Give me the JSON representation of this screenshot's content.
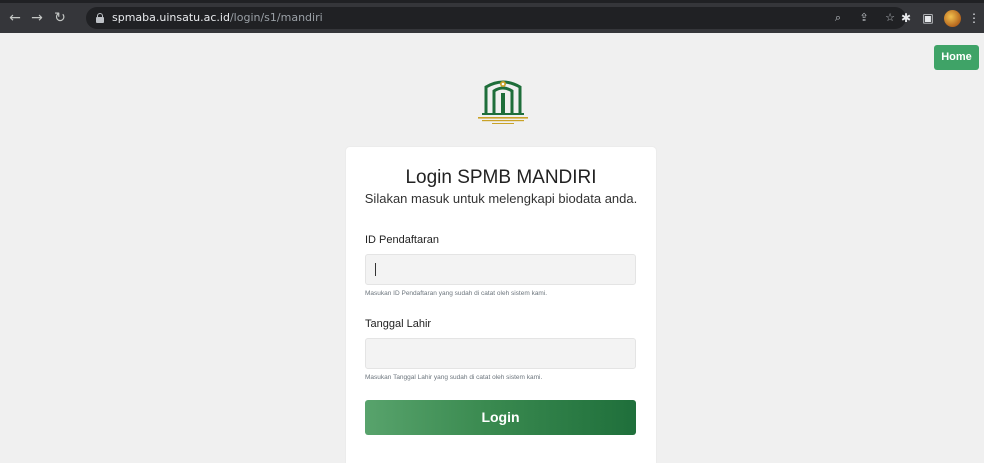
{
  "browser": {
    "url_host": "spmaba.uinsatu.ac.id",
    "url_path": "/login/s1/mandiri",
    "icons": [
      "back-arrow-icon",
      "forward-arrow-icon",
      "reload-icon",
      "lock-icon",
      "zoom-icon",
      "share-icon",
      "star-icon",
      "extensions-icon",
      "sidepanel-icon",
      "profile-avatar-icon",
      "more-menu-icon"
    ]
  },
  "header": {
    "home_label": "Home"
  },
  "logo": {
    "icon": "university-logo-icon"
  },
  "login": {
    "title": "Login SPMB MANDIRI",
    "subtitle": "Silakan masuk untuk melengkapi biodata anda.",
    "id_label": "ID Pendaftaran",
    "id_value": "",
    "id_help": "Masukan ID Pendaftaran yang sudah di catat oleh sistem kami.",
    "dob_label": "Tanggal Lahir",
    "dob_value": "",
    "dob_help": "Masukan Tanggal Lahir yang sudah di catat oleh sistem kami.",
    "button_label": "Login"
  },
  "colors": {
    "home_button": "#3fa367",
    "login_gradient_start": "#58a36c",
    "login_gradient_end": "#1f6f3b",
    "logo_green": "#1e6e3a",
    "logo_gold": "#c9a227"
  }
}
